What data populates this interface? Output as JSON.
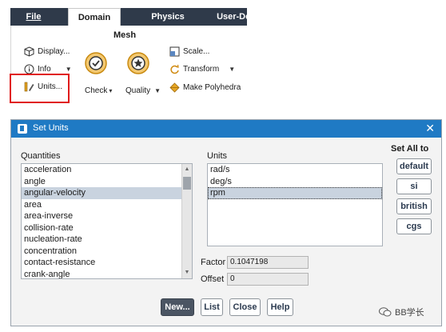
{
  "ribbon": {
    "tabs": [
      {
        "label": "File",
        "active": false
      },
      {
        "label": "Domain",
        "active": true
      },
      {
        "label": "Physics",
        "active": false
      },
      {
        "label": "User-Def",
        "active": false
      }
    ],
    "group_title": "Mesh",
    "items": {
      "display": "Display...",
      "info": "Info",
      "units": "Units...",
      "check": "Check",
      "quality": "Quality",
      "scale": "Scale...",
      "transform": "Transform",
      "make_polyhedra": "Make Polyhedra"
    }
  },
  "dialog": {
    "title": "Set Units",
    "close_glyph": "✕",
    "quantities_label": "Quantities",
    "quantities": [
      "acceleration",
      "angle",
      "angular-velocity",
      "area",
      "area-inverse",
      "collision-rate",
      "nucleation-rate",
      "concentration",
      "contact-resistance",
      "crank-angle"
    ],
    "selected_quantity": "angular-velocity",
    "units_label": "Units",
    "units": [
      "rad/s",
      "deg/s",
      "rpm"
    ],
    "selected_unit": "rpm",
    "factor_label": "Factor",
    "factor_value": "0.1047198",
    "offset_label": "Offset",
    "offset_value": "0",
    "set_all_label": "Set All to",
    "set_all_buttons": [
      "default",
      "si",
      "british",
      "cgs"
    ],
    "buttons": {
      "new": "New...",
      "list": "List",
      "close": "Close",
      "help": "Help"
    }
  },
  "watermark": {
    "text": "BB学长"
  },
  "colors": {
    "ribbon_tabbar": "#2f3a4a",
    "titlebar": "#1f7ac4",
    "highlight_box": "#e01b1b",
    "selection": "#c9d3df"
  }
}
